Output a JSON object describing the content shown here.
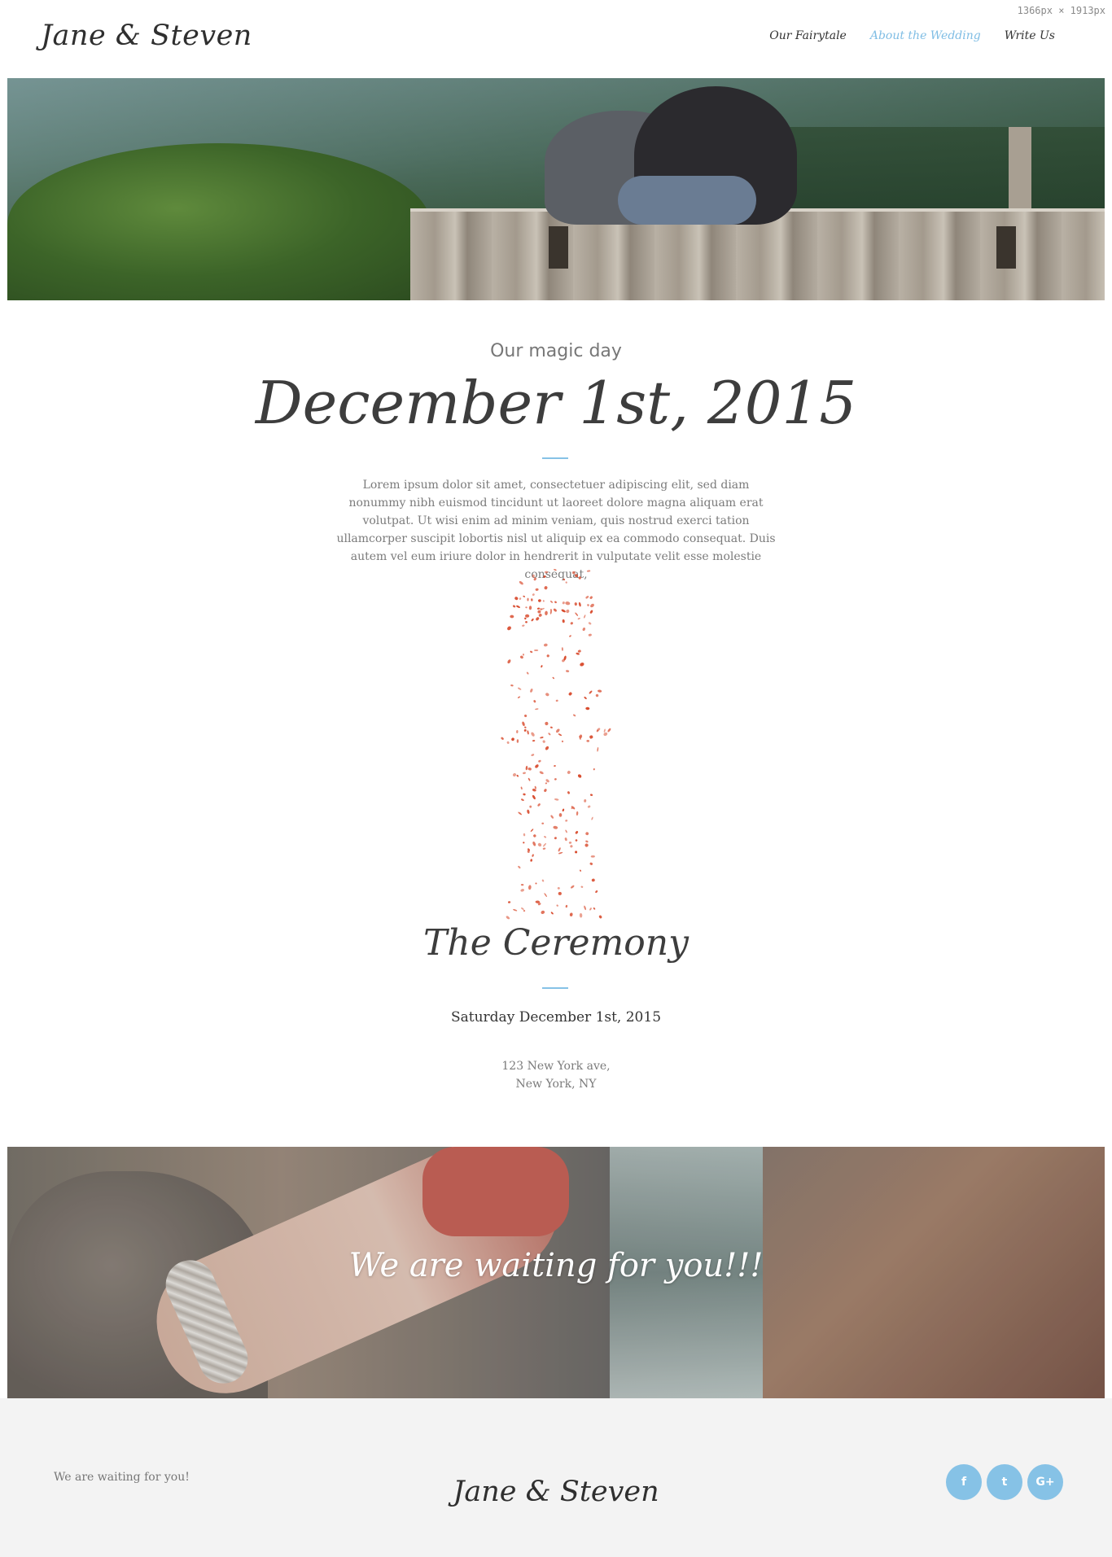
{
  "dimensions_label": "1366px × 1913px",
  "header": {
    "logo": "Jane & Steven",
    "nav": [
      {
        "label": "Our Fairytale"
      },
      {
        "label": "About the Wedding",
        "active": true
      },
      {
        "label": "Write Us"
      }
    ]
  },
  "intro": {
    "subtitle": "Our magic day",
    "date": "December 1st, 2015",
    "body": "Lorem ipsum dolor sit amet, consectetuer adipiscing elit, sed diam nonummy nibh euismod tincidunt ut laoreet dolore magna aliquam erat volutpat. Ut wisi enim ad minim veniam, quis nostrud exerci tation ullamcorper suscipit lobortis nisl ut aliquip ex ea commodo consequat. Duis autem vel eum iriure dolor in hendrerit in vulputate velit esse molestie consequat,"
  },
  "ceremony": {
    "title": "The Ceremony",
    "date": "Saturday December 1st, 2015",
    "address_line1": "123 New York ave,",
    "address_line2": "New York, NY"
  },
  "banner": {
    "text": "We are waiting for you!!!"
  },
  "footer": {
    "tagline": "We are waiting for you!",
    "logo": "Jane & Steven",
    "social": [
      {
        "icon": "facebook-icon",
        "glyph": "f"
      },
      {
        "icon": "twitter-icon",
        "glyph": "t"
      },
      {
        "icon": "google-plus-icon",
        "glyph": "G+"
      }
    ]
  },
  "colors": {
    "accent": "#86c2e6",
    "nav_active": "#7fbde4",
    "footer_bg": "#f3f3f3",
    "petal": "#d84a2c"
  }
}
